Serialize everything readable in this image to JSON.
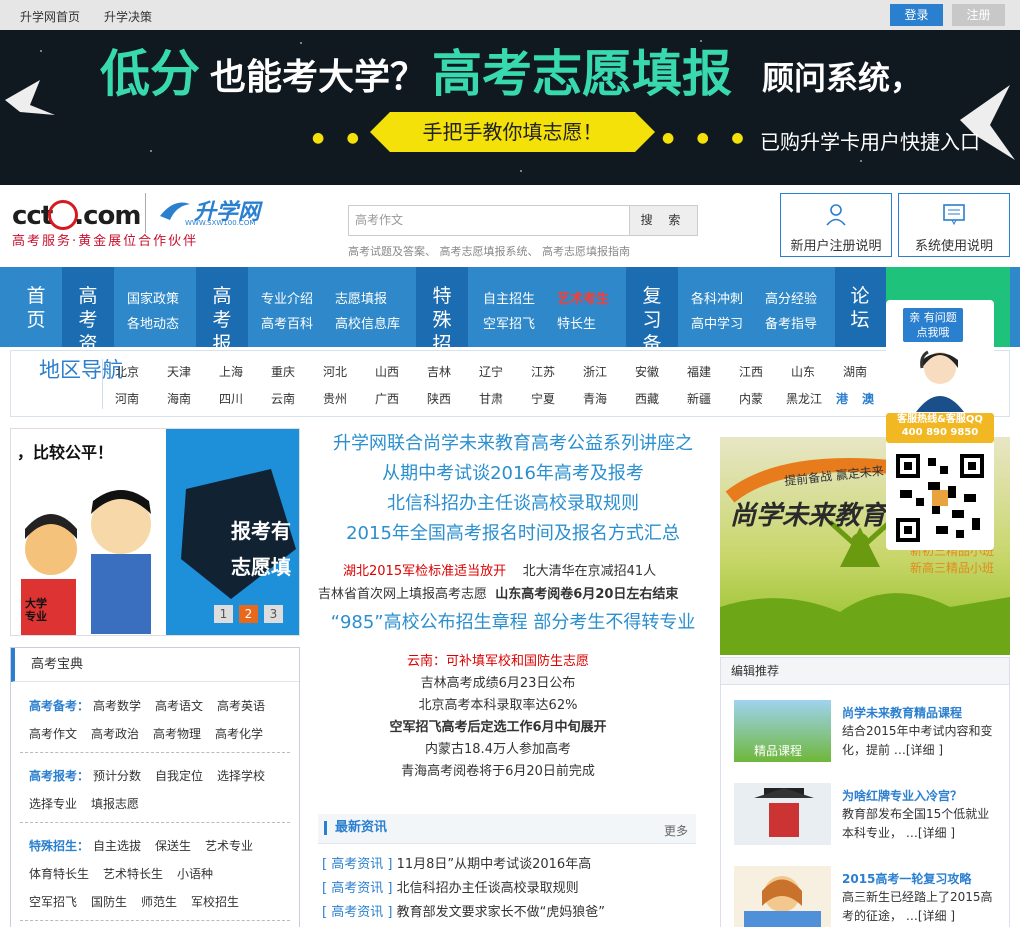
{
  "topbar": {
    "links": [
      "升学网首页",
      "升学决策"
    ],
    "login": "登录",
    "register": "注册"
  },
  "banner": {
    "part1": "低分",
    "part2": "也能考大学？",
    "part3": "高考志愿填报",
    "part4": "顾问系统，",
    "ribbon": "手把手教你填志愿！",
    "shortcut": "已购升学卡用户快捷入口"
  },
  "logo": {
    "cctv": "cctv.com",
    "brand": "升学网",
    "brand_url": "WWW.SXW100.COM",
    "slogan": "高考服务·黄金展位合作伙伴"
  },
  "search": {
    "placeholder": "高考作文",
    "button": "搜 索",
    "suggestions": "高考试题及答案、 高考志愿填报系统、 高考志愿填报指南"
  },
  "userboxes": [
    {
      "label": "新用户注册说明",
      "icon": "user-icon"
    },
    {
      "label": "系统使用说明",
      "icon": "message-icon"
    }
  ],
  "nav": {
    "home": "首页",
    "groups": [
      {
        "title": "高考资讯",
        "items": [
          "国家政策",
          "各地动态"
        ]
      },
      {
        "title": "高考报考",
        "items": [
          "专业介绍",
          "志愿填报",
          "高考百科",
          "高校信息库"
        ]
      },
      {
        "title": "特殊招生",
        "items": [
          "自主招生",
          "艺术考生",
          "空军招飞",
          "特长生"
        ]
      },
      {
        "title": "复习备考",
        "items": [
          "各科冲刺",
          "高分经验",
          "高中学习",
          "备考指导"
        ]
      },
      {
        "title": "论坛",
        "items": []
      }
    ]
  },
  "region": {
    "title": "地区导航",
    "row1": [
      "北京",
      "天津",
      "上海",
      "重庆",
      "河北",
      "山西",
      "吉林",
      "辽宁",
      "江苏",
      "浙江",
      "安徽",
      "福建",
      "江西",
      "山东",
      "湖南"
    ],
    "row2": [
      "河南",
      "海南",
      "四川",
      "云南",
      "贵州",
      "广西",
      "陕西",
      "甘肃",
      "宁夏",
      "青海",
      "西藏",
      "新疆",
      "内蒙",
      "黑龙江"
    ],
    "row2_bold": [
      "港",
      "澳"
    ]
  },
  "slideshow": {
    "caption_top": "，比较公平！",
    "caption_right1": "报考有",
    "caption_right2": "志愿填",
    "badge": "大学专业",
    "pages": [
      "1",
      "2",
      "3"
    ]
  },
  "baodian": {
    "title": "高考宝典",
    "sections": [
      {
        "key": "高考备考：",
        "items": [
          "高考数学",
          "高考语文",
          "高考英语",
          "高考作文",
          "高考政治",
          "高考物理",
          "高考化学"
        ]
      },
      {
        "key": "高考报考：",
        "items": [
          "预计分数",
          "自我定位",
          "选择学校",
          "选择专业",
          "填报志愿"
        ]
      },
      {
        "key": "特殊招生：",
        "items": [
          "自主选拔",
          "保送生",
          "艺术专业",
          "体育特长生",
          "艺术特长生",
          "小语种",
          "空军招飞",
          "国防生",
          "师范生",
          "军校招生"
        ]
      }
    ]
  },
  "center": {
    "headlines": [
      "升学网联合尚学未来教育高考公益系列讲座之",
      "从期中考试谈2016年高考及报考",
      "北信科招办主任谈高校录取规则",
      "2015年全国高考报名时间及报名方式汇总"
    ],
    "row1_red": "湖北2015军检标准适当放开",
    "row1_b": "北大清华在京减招41人",
    "row2_a": "吉林省首次网上填报高考志愿",
    "row2_b": "山东高考阅卷6月20日左右结束",
    "headline2": "“985”高校公布招生章程 部分考生不得转专业",
    "list_red": "云南：可补填军校和国防生志愿",
    "list": [
      "吉林高考成绩6月23日公布",
      "北京高考本科录取率达62%",
      "空军招飞高考后定选工作6月中旬展开",
      "内蒙古18.4万人参加高考",
      "青海高考阅卷将于6月20日前完成"
    ]
  },
  "news": {
    "title": "最新资讯",
    "more": "更多",
    "items": [
      {
        "cat": "[ 高考资讯 ]",
        "text": "11月8日”从期中考试谈2016年高"
      },
      {
        "cat": "[ 高考资讯 ]",
        "text": "北信科招办主任谈高校录取规则"
      },
      {
        "cat": "[ 高考资讯 ]",
        "text": "教育部发文要求家长不做“虎妈狼爸”"
      }
    ]
  },
  "promo": {
    "slogan": "提前备战 赢定未来",
    "brand": "尚学未来教育",
    "side1": "新初三精品小班",
    "side2": "新高三精品小班"
  },
  "editor": {
    "title": "编辑推荐",
    "items": [
      {
        "title": "尚学未来教育精品课程",
        "desc": "结合2015年中考试内容和变化，提前 …",
        "more": "[详细 ]",
        "thumb": "精品课程"
      },
      {
        "title": "为啥红牌专业入冷宫？",
        "desc": "教育部发布全国15个低就业本科专业， …",
        "more": "[详细 ]",
        "thumb": ""
      },
      {
        "title": "2015高考一轮复习攻略",
        "desc": "高三新生已经踏上了2015高考的征途， …",
        "more": "[详细 ]",
        "thumb": ""
      }
    ]
  },
  "service": {
    "bubble": "亲 有问题 点我哦",
    "hotline": "客服热线&客服QQ",
    "number": "400 890 9850"
  },
  "colors": {
    "primary": "#2b7fcf",
    "nav": "#2e88c9",
    "green": "#1fc27a",
    "red": "#d00000"
  }
}
